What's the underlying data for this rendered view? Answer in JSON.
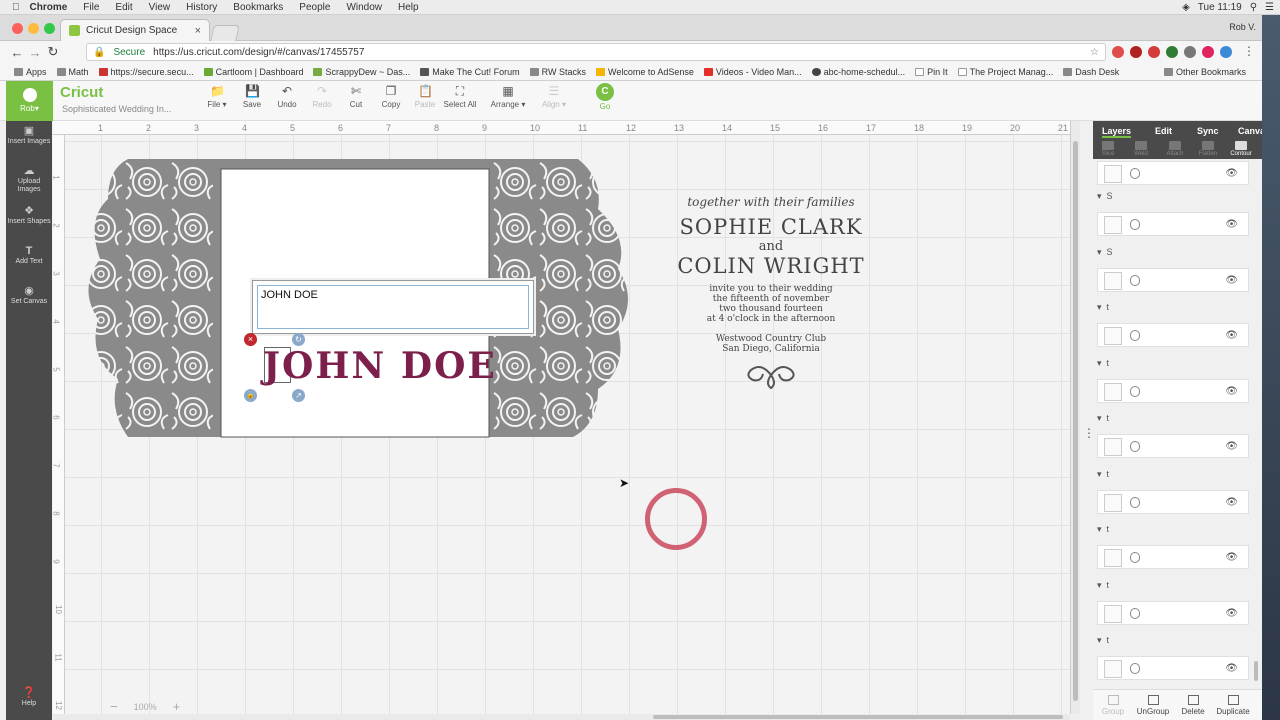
{
  "os_menu": {
    "app": "Chrome",
    "items": [
      "File",
      "Edit",
      "View",
      "History",
      "Bookmarks",
      "People",
      "Window",
      "Help"
    ],
    "clock": "Tue 11:19",
    "user": "Rob V."
  },
  "browser": {
    "tab_title": "Cricut Design Space",
    "secure_label": "Secure",
    "url": "https://us.cricut.com/design/#/canvas/17455757",
    "bookmarks": [
      "Apps",
      "Math",
      "https://secure.secu...",
      "Cartloom | Dashboard",
      "ScrappyDew ~ Das...",
      "Make The Cut! Forum",
      "RW Stacks",
      "Welcome to AdSense",
      "Videos - Video Man...",
      "abc-home-schedul...",
      "Pin It",
      "The Project Manag...",
      "Dash Desk"
    ],
    "other_bookmarks": "Other Bookmarks"
  },
  "app": {
    "user": "Rob",
    "logo": "Cricut",
    "project_name": "Sophisticated Wedding In...",
    "tools": {
      "file": "File",
      "save": "Save",
      "undo": "Undo",
      "redo": "Redo",
      "cut": "Cut",
      "copy": "Copy",
      "paste": "Paste",
      "select_all": "Select All",
      "arrange": "Arrange",
      "align": "Align",
      "go": "Go"
    },
    "left_tools": [
      "Insert Images",
      "Upload Images",
      "Insert Shapes",
      "Add Text",
      "Set Canvas",
      "Help"
    ]
  },
  "canvas": {
    "ruler_top": [
      "1",
      "2",
      "3",
      "4",
      "5",
      "6",
      "7",
      "8",
      "9",
      "10",
      "11",
      "12",
      "13",
      "14",
      "15",
      "16",
      "17",
      "18",
      "19",
      "20",
      "21"
    ],
    "ruler_left": [
      "1",
      "2",
      "3",
      "4",
      "5",
      "6",
      "7",
      "8",
      "9",
      "10",
      "11",
      "12"
    ],
    "edit_text_value": "JOHN DOE",
    "johndoe": "JOHN DOE",
    "invite": {
      "line1": "together with their families",
      "name1": "SOPHIE CLARK",
      "and": "and",
      "name2": "COLIN WRIGHT",
      "l3": "invite you to their wedding",
      "l4": "the fifteenth of november",
      "l5": "two thousand fourteen",
      "l6": "at 4 o'clock in the afternoon",
      "venue1": "Westwood Country Club",
      "venue2": "San Diego, California"
    },
    "zoom": "100%"
  },
  "panel": {
    "tabs": [
      "Layers",
      "Edit",
      "Sync",
      "Canvas"
    ],
    "actions": [
      "Slice",
      "Weld",
      "Attach",
      "Flatten",
      "Contour"
    ],
    "groups": [
      "S",
      "S",
      "t",
      "t",
      "t",
      "t",
      "t",
      "t",
      "t"
    ],
    "bottom": [
      "Group",
      "UnGroup",
      "Delete",
      "Duplicate"
    ]
  },
  "colors": {
    "accent": "#7ac143",
    "text_fill": "#7d1f4b",
    "cursor_circle": "#c9485d",
    "lace": "#8a8a8a"
  }
}
